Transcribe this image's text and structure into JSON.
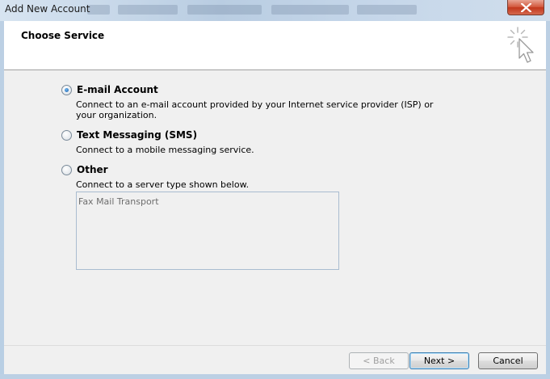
{
  "window": {
    "title": "Add New Account",
    "close_icon": "close-icon"
  },
  "header": {
    "title": "Choose Service",
    "icon": "wizard-cursor-icon"
  },
  "options": [
    {
      "label": "E-mail Account",
      "description_line1": "Connect to an e-mail account provided by your Internet service provider (ISP) or",
      "description_line2": "your organization.",
      "selected": true
    },
    {
      "label": "Text Messaging (SMS)",
      "description_line1": "Connect to a mobile messaging service.",
      "selected": false
    },
    {
      "label": "Other",
      "description_line1": "Connect to a server type shown below.",
      "selected": false
    }
  ],
  "server_types": [
    "Fax Mail Transport"
  ],
  "buttons": {
    "back": "< Back",
    "next": "Next >",
    "cancel": "Cancel"
  }
}
